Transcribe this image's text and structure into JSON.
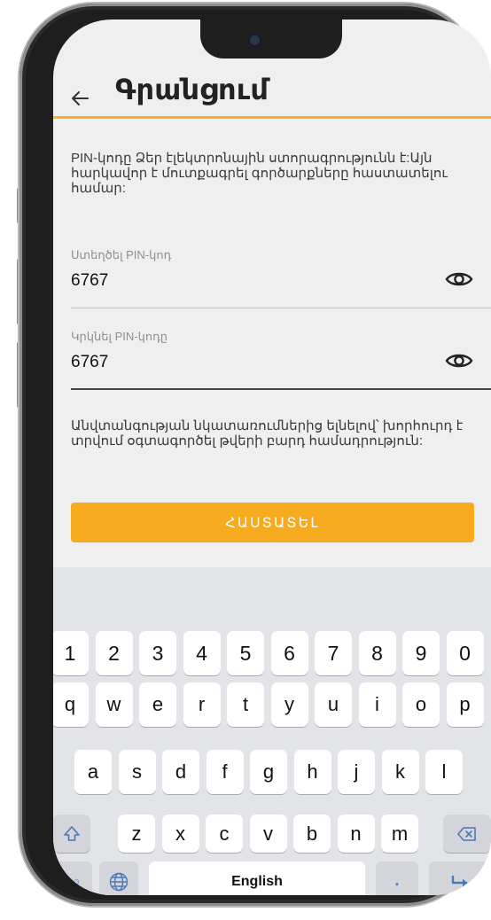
{
  "header": {
    "title": "Գրանցում",
    "back_icon": "arrow-left-icon"
  },
  "info_text": "PIN-կոդը Ձեր էլեկտրոնային ստորագրությունն է:Այն հարկավոր է մուտքագրել գործարքները հաստատելու համար:",
  "create_pin": {
    "label": "Ստեղծել PIN-կոդ",
    "value": "6767",
    "toggle_icon": "eye-icon"
  },
  "repeat_pin": {
    "label": "Կրկնել PIN-կոդը",
    "value": "6767",
    "toggle_icon": "eye-icon"
  },
  "note_text": "Անվտանգության նկատառումներից ելնելով՝ խորհուրդ է տրվում օգտագործել թվերի բարդ համադրություն:",
  "confirm_button": "ՀԱՍՏԱՏԵԼ",
  "colors": {
    "accent": "#f5ab1d",
    "header_line": "#f3b22a",
    "screen_bg": "#efefef",
    "keyboard_bg": "#e3e4e8"
  },
  "keyboard": {
    "numbers": [
      "1",
      "2",
      "3",
      "4",
      "5",
      "6",
      "7",
      "8",
      "9",
      "0"
    ],
    "row1": [
      "q",
      "w",
      "e",
      "r",
      "t",
      "y",
      "u",
      "i",
      "o",
      "p"
    ],
    "row2": [
      "a",
      "s",
      "d",
      "f",
      "g",
      "h",
      "j",
      "k",
      "l"
    ],
    "row3": [
      "z",
      "x",
      "c",
      "v",
      "b",
      "n",
      "m"
    ],
    "symbols_key": "!#☺",
    "space_label": "English",
    "period": ".",
    "shift_icon": "shift-icon",
    "backspace_icon": "backspace-icon",
    "globe_icon": "globe-icon",
    "enter_icon": "enter-icon"
  }
}
